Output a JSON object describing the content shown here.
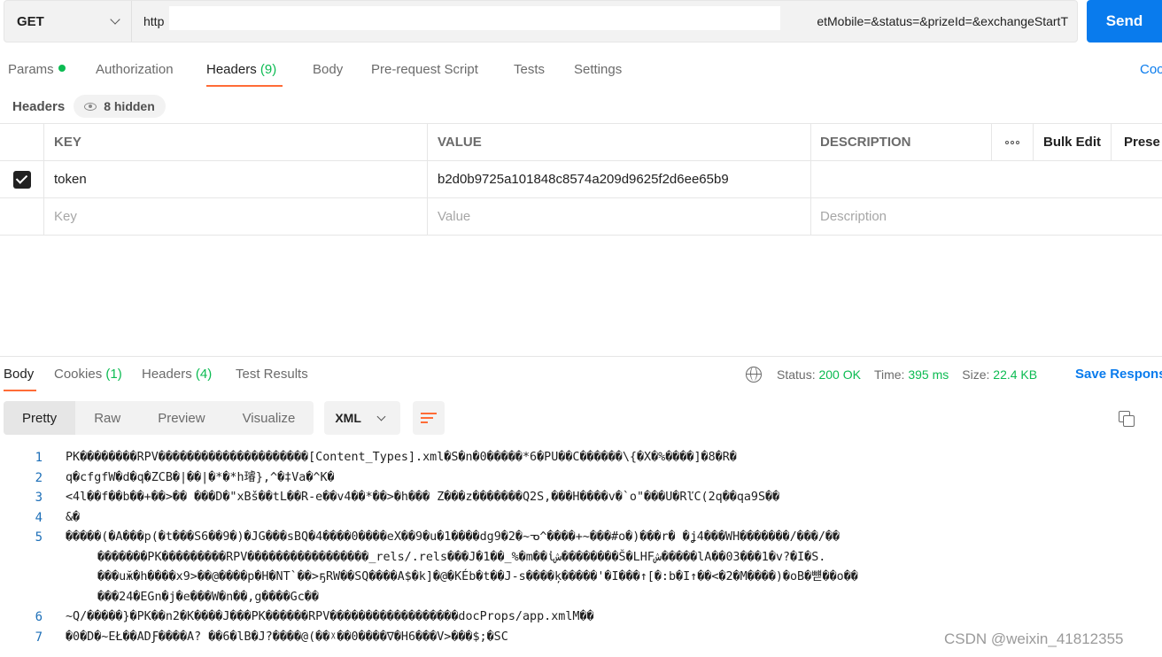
{
  "request": {
    "method": "GET",
    "url_start": "http",
    "url_end": "etMobile=&status=&prizeId=&exchangeStartT",
    "send_label": "Send"
  },
  "request_tabs": [
    {
      "label": "Params",
      "count": ""
    },
    {
      "label": "Authorization",
      "count": ""
    },
    {
      "label": "Headers",
      "count": "(9)"
    },
    {
      "label": "Body",
      "count": ""
    },
    {
      "label": "Pre-request Script",
      "count": ""
    },
    {
      "label": "Tests",
      "count": ""
    },
    {
      "label": "Settings",
      "count": ""
    }
  ],
  "cookies_link": "Coo",
  "headers_section": {
    "title": "Headers",
    "hidden_label": "8 hidden"
  },
  "table": {
    "columns": {
      "key": "KEY",
      "value": "VALUE",
      "description": "DESCRIPTION",
      "bulk_edit": "Bulk Edit",
      "presets": "Prese"
    },
    "rows": [
      {
        "key": "token",
        "value": "b2d0b9725a101848c8574a209d9625f2d6ee65b9",
        "description": ""
      }
    ],
    "placeholders": {
      "key": "Key",
      "value": "Value",
      "description": "Description"
    }
  },
  "response": {
    "tabs": [
      {
        "label": "Body",
        "count": ""
      },
      {
        "label": "Cookies",
        "count": "(1)"
      },
      {
        "label": "Headers",
        "count": "(4)"
      },
      {
        "label": "Test Results",
        "count": ""
      }
    ],
    "status_label": "Status:",
    "status_value": "200 OK",
    "time_label": "Time:",
    "time_value": "395 ms",
    "size_label": "Size:",
    "size_value": "22.4 KB",
    "save_label": "Save Respons",
    "view_modes": [
      "Pretty",
      "Raw",
      "Preview",
      "Visualize"
    ],
    "format": "XML"
  },
  "code_lines": [
    {
      "num": "1",
      "text": "PK��������RPV���������������������[Content_Types].xml�S�n�0�����*6�PU��C������\\{�X�%����]�8�R�"
    },
    {
      "num": "2",
      "text": "q�cfgfW�d�q�ZCB�|��|�*�*h璿},^�‡Va�^K�"
    },
    {
      "num": "3",
      "text": "<4l��f��b��+��>�� ���D�\"xBš��tL��R-e��v4��*��>�h���   Z���z�������Q2S,���H����v�`o\"���U�RľC(2q��qa9S��"
    },
    {
      "num": "4",
      "text": "&�"
    },
    {
      "num": "5",
      "text": "�����(�A���p(�t���S6��9�)�JG���sBQ�4����0����eX��9�u�1����dg9�2�~ᓀ^����+~���#o�)���r�   �ʝ4���WH�������/���/��"
    },
    {
      "num": "",
      "text": "�������PK���������RPV�����������������_rels/.rels���J�1��_%�m��ἰش��������Š�LHFش�����lA��03���1�v?�I�S."
    },
    {
      "num": "",
      "text": "���uӂ�h����x9>��@����p�H�NT`��>ҕRW��SQ����A$�k]�@�KÉb�t��J-s����ķ�����'�I���↑[�:b�I↑��<�2�M����)�oB�뺻��o��"
    },
    {
      "num": "",
      "text": "���24�EGn�j�e���W�n��,g����Gc��"
    },
    {
      "num": "6",
      "text": "~Q/�����}�PK��n2�K����J���PK������RPV������������������docProps/app.xmlM��"
    },
    {
      "num": "7",
      "text": "�0�D�~EŁ��ADƑ����A? ��6�lB�J?����@(��ᵡ��0����∇�H6���V>���$;�SC"
    }
  ],
  "watermark": "CSDN @weixin_41812355",
  "colors": {
    "accent": "#ff6c37",
    "send": "#097bed",
    "success": "#0cbb52",
    "line_numbers": "#1d6fb8"
  }
}
